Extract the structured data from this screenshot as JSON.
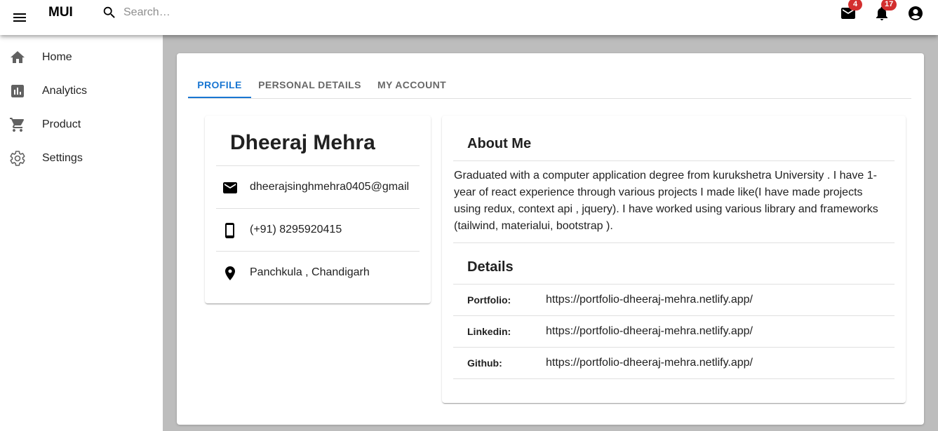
{
  "appbar": {
    "brand": "MUI",
    "search_placeholder": "Search…",
    "mail_badge": "4",
    "notifications_badge": "17"
  },
  "sidebar": {
    "items": [
      {
        "label": "Home",
        "icon": "home-icon"
      },
      {
        "label": "Analytics",
        "icon": "analytics-icon"
      },
      {
        "label": "Product",
        "icon": "cart-icon"
      },
      {
        "label": "Settings",
        "icon": "gear-icon"
      }
    ]
  },
  "tabs": [
    {
      "label": "PROFILE",
      "active": true
    },
    {
      "label": "PERSONAL DETAILS",
      "active": false
    },
    {
      "label": "MY ACCOUNT",
      "active": false
    }
  ],
  "profile": {
    "name": "Dheeraj Mehra",
    "email": "dheerajsinghmehra0405@gmail",
    "phone": "(+91) 8295920415",
    "location": "Panchkula , Chandigarh"
  },
  "about": {
    "title": "About Me",
    "text": "Graduated with a computer application degree from kurukshetra University . I have 1-year of react experience through various projects I made like(I have made projects using redux, context api , jquery). I have worked using various library and frameworks (tailwind, materialui, bootstrap ).",
    "details_title": "Details",
    "details": [
      {
        "label": "Portfolio:",
        "value": "https://portfolio-dheeraj-mehra.netlify.app/"
      },
      {
        "label": "Linkedin:",
        "value": "https://portfolio-dheeraj-mehra.netlify.app/"
      },
      {
        "label": "Github:",
        "value": "https://portfolio-dheeraj-mehra.netlify.app/"
      }
    ]
  },
  "colors": {
    "primary": "#1976d2",
    "badge": "#d32f2f",
    "background": "#bdbdbd"
  }
}
